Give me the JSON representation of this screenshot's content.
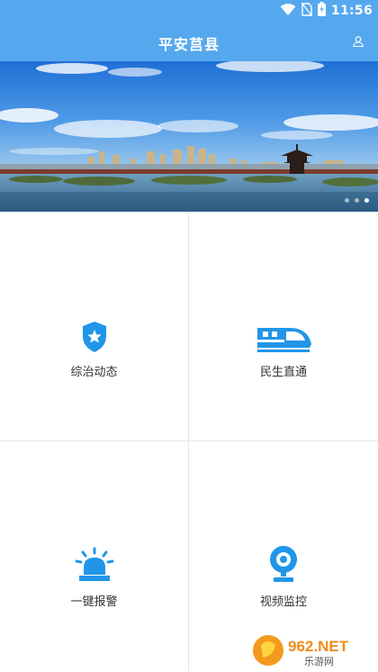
{
  "status": {
    "time": "11:56",
    "icons": [
      "wifi-icon",
      "no-sim-icon",
      "battery-icon"
    ]
  },
  "header": {
    "title": "平安莒县",
    "user_icon": "user-icon",
    "color": "#56a8ee"
  },
  "banner": {
    "slide_count": 3,
    "active_index": 2
  },
  "menu": [
    {
      "label": "综治动态",
      "icon": "shield-star-icon"
    },
    {
      "label": "民生直通",
      "icon": "train-icon"
    },
    {
      "label": "一键报警",
      "icon": "alarm-siren-icon"
    },
    {
      "label": "视频监控",
      "icon": "camera-icon"
    }
  ],
  "accent": "#2196e8",
  "watermark": {
    "brand": "962.NET",
    "sub": "乐游网"
  }
}
